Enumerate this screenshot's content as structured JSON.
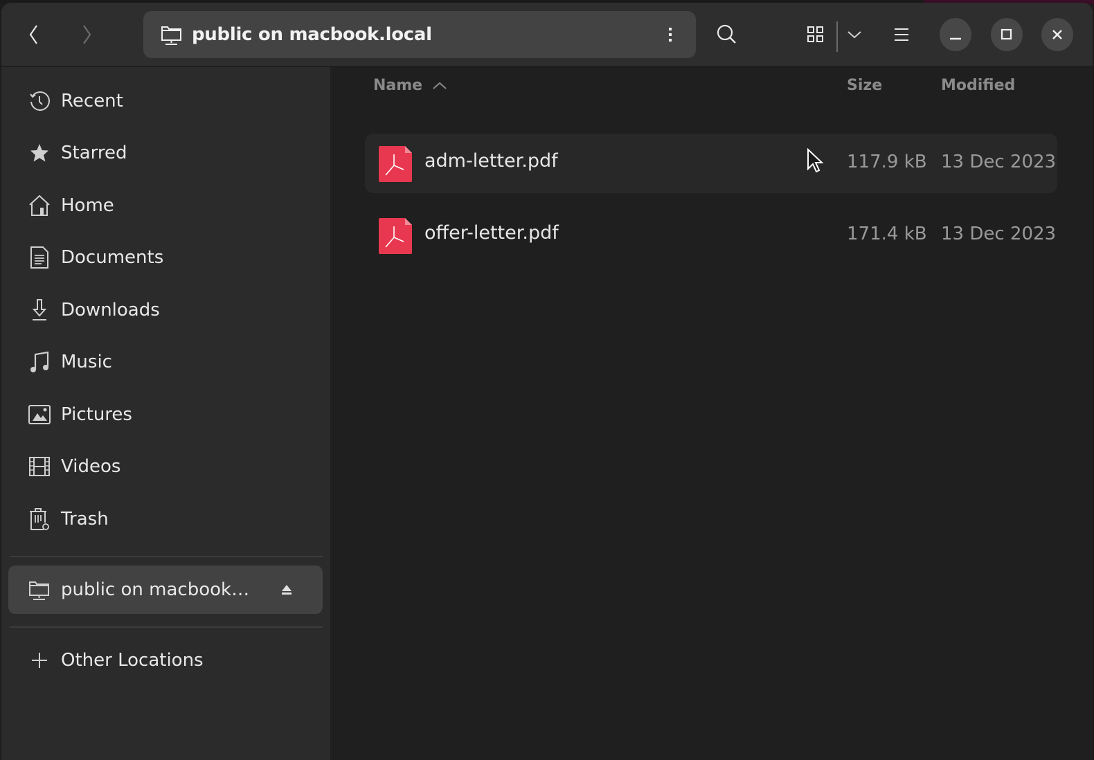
{
  "window": {
    "title": "public on macbook.local"
  },
  "headerbar": {
    "back_icon": "chevron-left-icon",
    "forward_icon": "chevron-right-icon",
    "path_icon": "network-folder-icon",
    "path_label": "public on macbook.local",
    "path_menu_icon": "vertical-ellipsis-icon",
    "search_icon": "search-icon",
    "view_icon": "grid-view-icon",
    "view_dropdown_icon": "chevron-down-icon",
    "menu_icon": "hamburger-menu-icon",
    "minimize_icon": "minimize-icon",
    "maximize_icon": "maximize-icon",
    "close_icon": "close-icon"
  },
  "sidebar": {
    "items": [
      {
        "label": "Recent",
        "icon": "clock-icon"
      },
      {
        "label": "Starred",
        "icon": "star-icon"
      },
      {
        "label": "Home",
        "icon": "home-icon"
      },
      {
        "label": "Documents",
        "icon": "document-icon"
      },
      {
        "label": "Downloads",
        "icon": "download-icon"
      },
      {
        "label": "Music",
        "icon": "music-note-icon"
      },
      {
        "label": "Pictures",
        "icon": "picture-icon"
      },
      {
        "label": "Videos",
        "icon": "film-icon"
      },
      {
        "label": "Trash",
        "icon": "trash-icon"
      }
    ],
    "mounts": [
      {
        "label": "public on macbook…",
        "icon": "network-folder-icon",
        "action_icon": "eject-icon",
        "active": true
      }
    ],
    "other_locations": {
      "label": "Other Locations",
      "icon": "plus-icon"
    }
  },
  "file_list": {
    "columns": {
      "name": "Name",
      "size": "Size",
      "modified": "Modified",
      "sort_indicator": "sort-ascending-icon"
    },
    "rows": [
      {
        "name": "adm-letter.pdf",
        "size": "117.9 kB",
        "modified": "13 Dec 2023",
        "icon": "pdf-file-icon",
        "hovered": true
      },
      {
        "name": "offer-letter.pdf",
        "size": "171.4 kB",
        "modified": "13 Dec 2023",
        "icon": "pdf-file-icon",
        "hovered": false
      }
    ]
  },
  "colors": {
    "pdf_icon": "#e8384f",
    "headerbar": "#2e2e2e",
    "sidebar": "#2b2b2b",
    "content": "#1f1f1f"
  }
}
